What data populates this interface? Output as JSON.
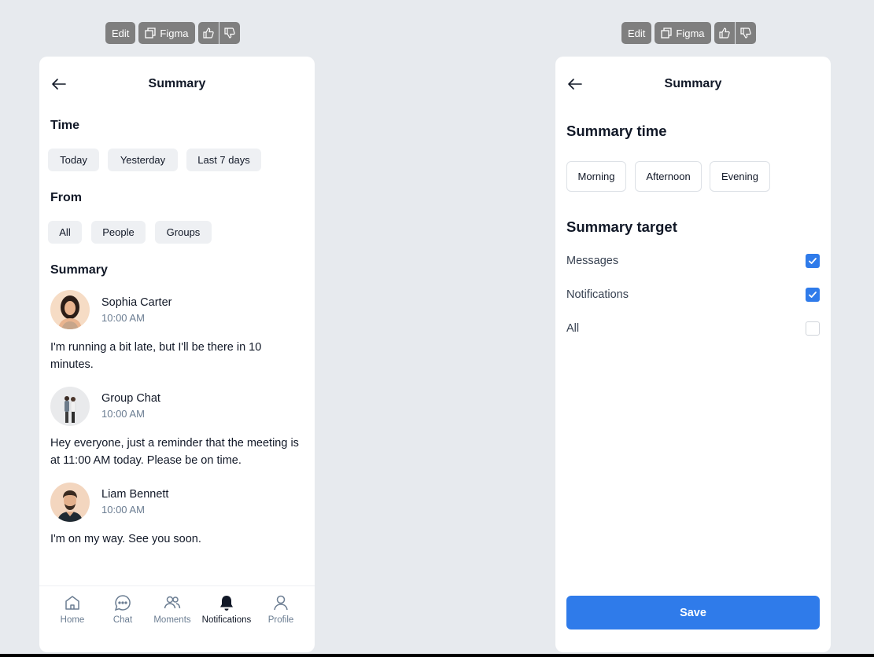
{
  "toolbar": {
    "edit_label": "Edit",
    "figma_label": "Figma",
    "like_icon": "thumbs-up-icon",
    "dislike_icon": "thumbs-down-icon"
  },
  "summary_screen": {
    "title": "Summary",
    "time_section": "Time",
    "time_chips": [
      "Today",
      "Yesterday",
      "Last 7 days"
    ],
    "from_section": "From",
    "from_chips": [
      "All",
      "People",
      "Groups"
    ],
    "summary_section": "Summary",
    "entries": [
      {
        "name": "Sophia Carter",
        "time": "10:00 AM",
        "message": "I'm running a bit late, but I'll be there in 10 minutes."
      },
      {
        "name": "Group Chat",
        "time": "10:00 AM",
        "message": "Hey everyone, just a reminder that the meeting is at 11:00 AM today. Please be on time."
      },
      {
        "name": "Liam Bennett",
        "time": "10:00 AM",
        "message": "I'm on my way. See you soon."
      }
    ],
    "nav": [
      {
        "label": "Home",
        "icon": "home-icon"
      },
      {
        "label": "Chat",
        "icon": "chat-icon"
      },
      {
        "label": "Moments",
        "icon": "moments-icon"
      },
      {
        "label": "Notifications",
        "icon": "bell-icon",
        "active": true
      },
      {
        "label": "Profile",
        "icon": "profile-icon"
      }
    ]
  },
  "settings_screen": {
    "title": "Summary",
    "time_section": "Summary time",
    "time_options": [
      "Morning",
      "Afternoon",
      "Evening"
    ],
    "target_section": "Summary target",
    "targets": [
      {
        "label": "Messages",
        "checked": true
      },
      {
        "label": "Notifications",
        "checked": true
      },
      {
        "label": "All",
        "checked": false
      }
    ],
    "save_label": "Save"
  },
  "colors": {
    "accent": "#2f7bea",
    "background": "#e7eaee",
    "chip_bg": "#eef0f3",
    "muted_text": "#6b7d92"
  }
}
